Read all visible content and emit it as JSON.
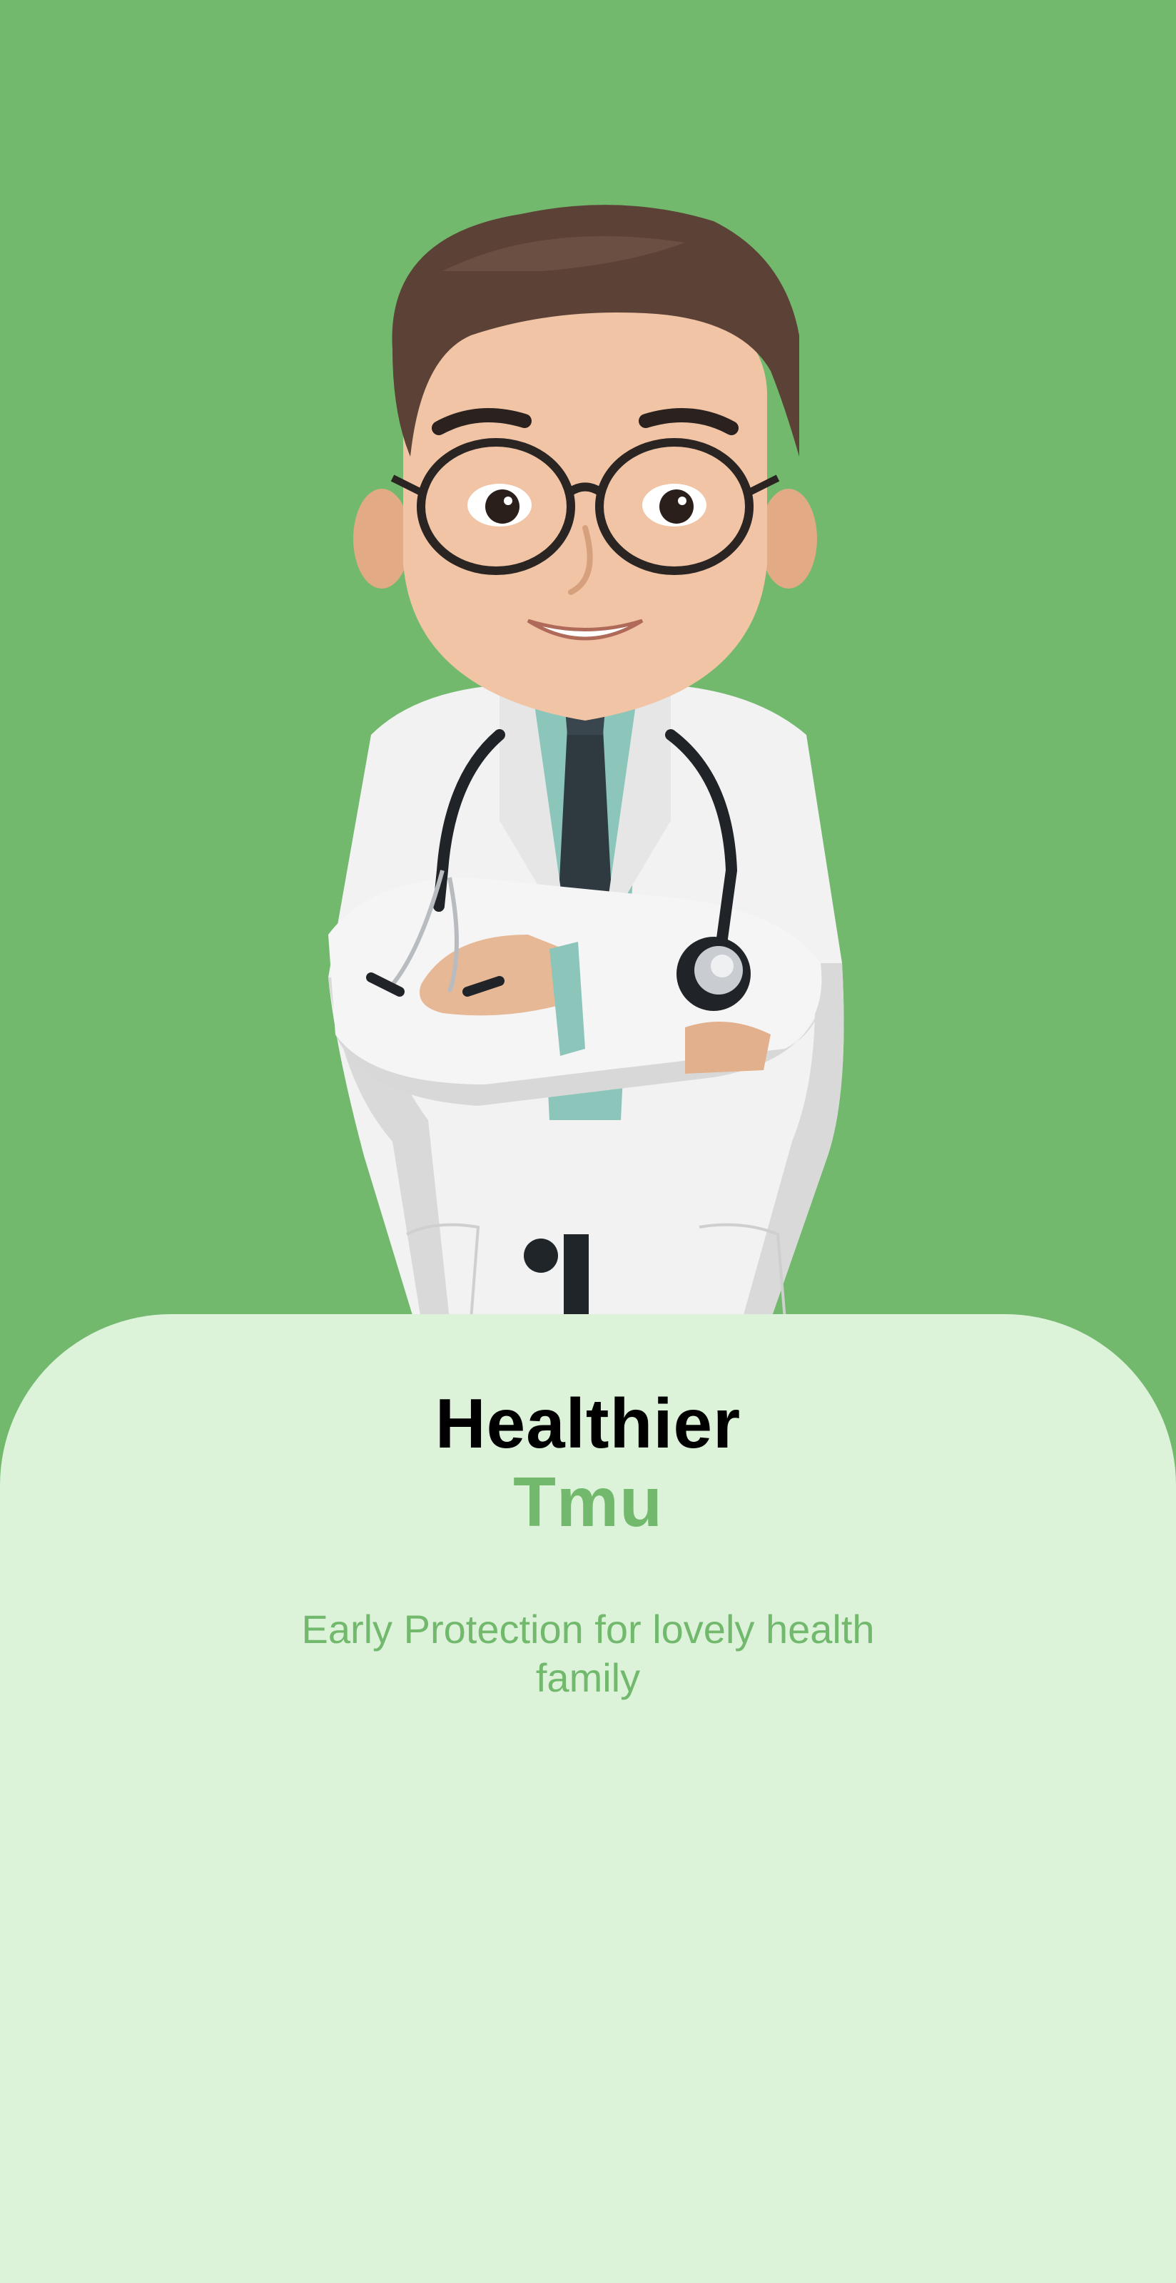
{
  "colors": {
    "hero_background": "#72b96e",
    "card_background": "#dcf3da",
    "accent": "#72b96e",
    "title": "#000000"
  },
  "hero": {
    "illustration": "doctor-illustration"
  },
  "card": {
    "title_line1": "Healthier",
    "title_line2": "Tmu",
    "subtitle": "Early Protection for lovely health family"
  }
}
